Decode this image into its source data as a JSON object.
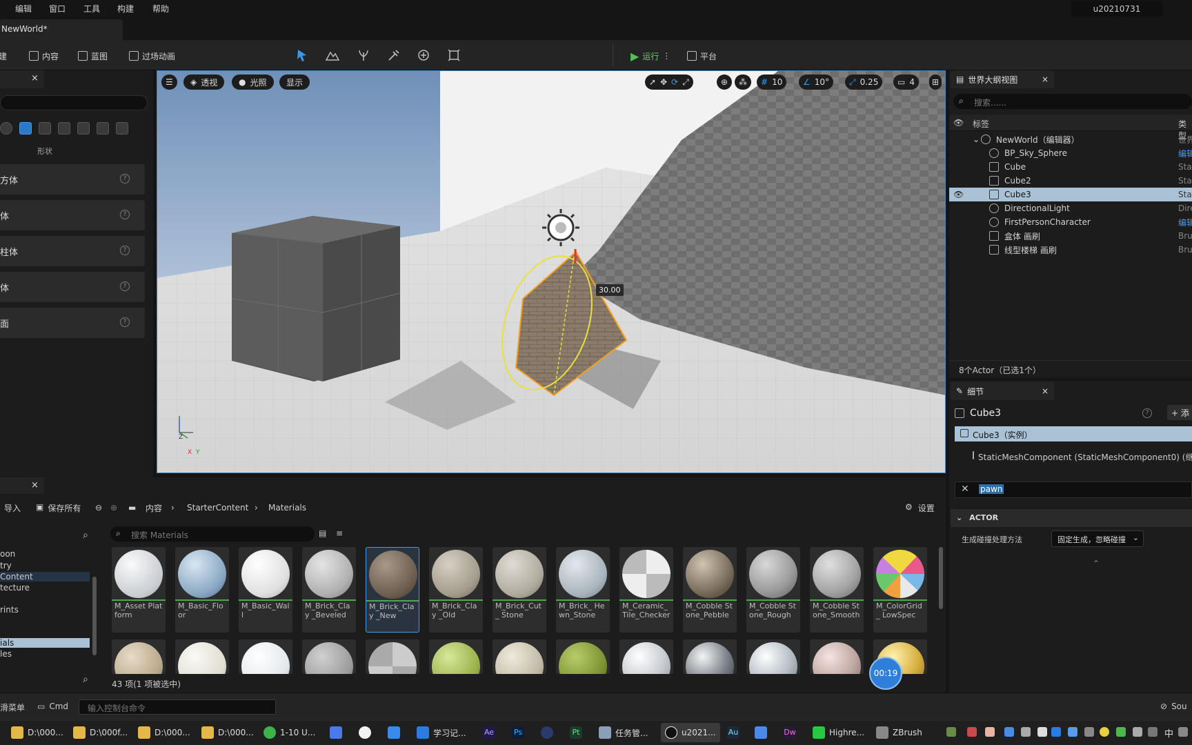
{
  "menu": [
    "编辑",
    "窗口",
    "工具",
    "构建",
    "帮助"
  ],
  "user": "u20210731",
  "doc_tab": "NewWorld*",
  "toolbar": {
    "create": "创建",
    "content": "内容",
    "blueprint": "蓝图",
    "cinematics": "过场动画",
    "play": "运行",
    "platform": "平台"
  },
  "left_panel": {
    "shape_label": "形状",
    "shapes": [
      "方体",
      "体",
      "柱体",
      "体",
      "面"
    ]
  },
  "viewport": {
    "perspective": "透视",
    "lit": "光照",
    "show": "显示",
    "grid": "10",
    "angle": "10°",
    "scale": "0.25",
    "camera": "4",
    "rotation_value": "30.00",
    "axis_z": "Z",
    "axis_x": "X",
    "axis_y": "Y"
  },
  "outliner": {
    "tab": "世界大纲视图",
    "search_placeholder": "搜索......",
    "col_label": "标签",
    "col_type": "类型",
    "rows": [
      {
        "name": "NewWorld（编辑器）",
        "type": "世界"
      },
      {
        "name": "BP_Sky_Sphere",
        "type": "编辑"
      },
      {
        "name": "Cube",
        "type": "Sta"
      },
      {
        "name": "Cube2",
        "type": "Sta"
      },
      {
        "name": "Cube3",
        "type": "Sta"
      },
      {
        "name": "DirectionalLight",
        "type": "Dire"
      },
      {
        "name": "FirstPersonCharacter",
        "type": "编辑"
      },
      {
        "name": "盒体 画刷",
        "type": "Bru"
      },
      {
        "name": "线型楼梯 画刷",
        "type": "Bru"
      }
    ],
    "footer": "8个Actor（已选1个）"
  },
  "details": {
    "tab": "细节",
    "object": "Cube3",
    "add": "添",
    "instance": "Cube3（实例）",
    "component": "StaticMeshComponent (StaticMeshComponent0) (继",
    "filter": "pawn",
    "section": "ACTOR",
    "prop_label": "生成碰撞处理方法",
    "prop_value": "固定生成，忽略碰撞"
  },
  "content_browser": {
    "import": "导入",
    "save_all": "保存所有",
    "path": [
      "内容",
      "StarterContent",
      "Materials"
    ],
    "settings": "设置",
    "search_placeholder": "搜索 Materials",
    "tree": [
      "oon",
      "try",
      "Content",
      "tecture",
      "rints",
      "ials",
      "les"
    ],
    "assets": [
      "M_Asset Platform",
      "M_Basic_Floor",
      "M_Basic_Wall",
      "M_Brick_Clay _Beveled",
      "M_Brick_Clay _New",
      "M_Brick_Clay _Old",
      "M_Brick_Cut_ Stone",
      "M_Brick_ Hewn_Stone",
      "M_Ceramic_ Tile_Checker",
      "M_Cobble Stone_Pebble",
      "M_Cobble Stone_Rough",
      "M_Cobble Stone_Smooth",
      "M_ColorGrid_ LowSpec"
    ],
    "count": "43 项(1 项被选中)",
    "timer": "00:19"
  },
  "status": {
    "menu": "滑菜单",
    "cmd": "Cmd",
    "console_placeholder": "输入控制台命令",
    "source": "Sou"
  },
  "taskbar": [
    {
      "label": "D:\\000...",
      "color": "#e5b64a"
    },
    {
      "label": "D:\\000f...",
      "color": "#e5b64a"
    },
    {
      "label": "D:\\000...",
      "color": "#e5b64a"
    },
    {
      "label": "D:\\000...",
      "color": "#e5b64a"
    },
    {
      "label": "1-10 U...",
      "color": "#3bb34a"
    },
    {
      "label": "学习记...",
      "color": "#2e7be0"
    },
    {
      "label": "任务管...",
      "color": "#8aa0b8"
    },
    {
      "label": "u2021...",
      "color": "#111111"
    },
    {
      "label": "Highre...",
      "color": "#28c840"
    },
    {
      "label": "ZBrush",
      "color": "#888888"
    }
  ],
  "taskbar_apps": [
    "Ae",
    "Ps",
    "Pt",
    "Au",
    "Dw"
  ],
  "clock_char": "中"
}
